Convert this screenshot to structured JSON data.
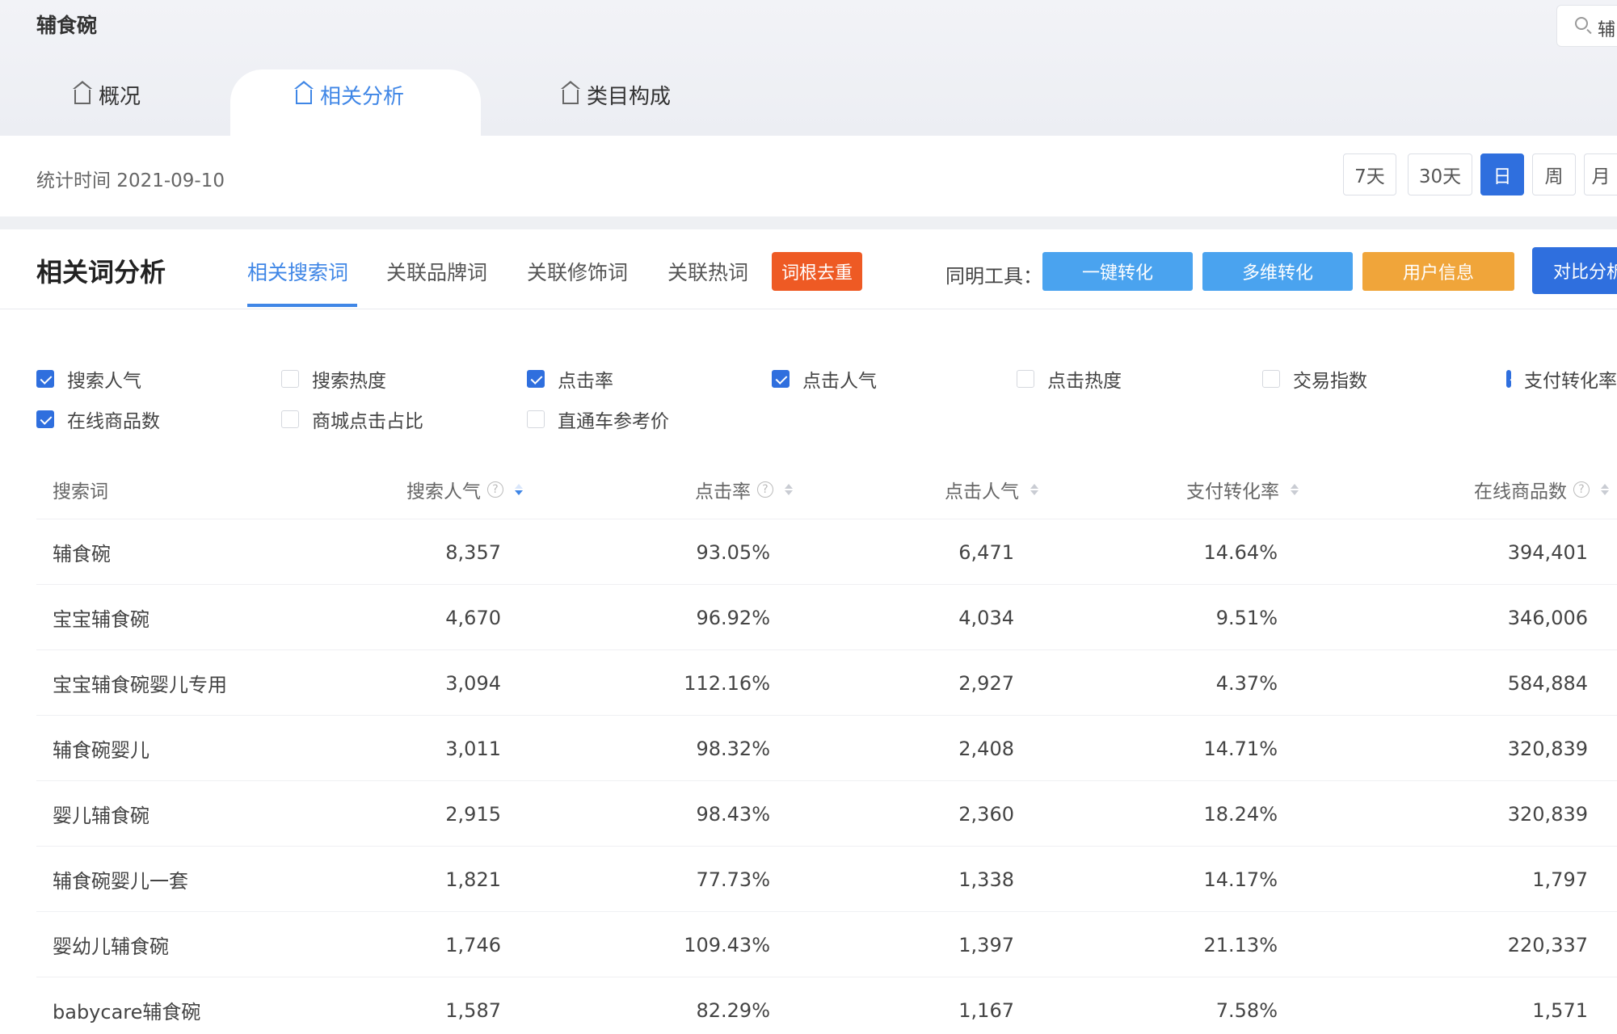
{
  "header": {
    "title": "辅食碗",
    "search_value": "辅",
    "tabs": [
      {
        "label": "概况",
        "active": false
      },
      {
        "label": "相关分析",
        "active": true
      },
      {
        "label": "类目构成",
        "active": false
      }
    ]
  },
  "stats": {
    "time_text": "统计时间 2021-09-10",
    "periods": [
      {
        "label": "7天",
        "active": false
      },
      {
        "label": "30天",
        "active": false
      },
      {
        "label": "日",
        "active": true
      },
      {
        "label": "周",
        "active": false
      },
      {
        "label": "月",
        "active": false
      }
    ]
  },
  "analysis": {
    "title": "相关词分析",
    "sub_tabs": [
      "相关搜索词",
      "关联品牌词",
      "关联修饰词",
      "关联热词"
    ],
    "dedup_label": "词根去重",
    "tools_label": "同明工具：",
    "tools": [
      {
        "label": "一键转化",
        "color": "#4aa3ef"
      },
      {
        "label": "多维转化",
        "color": "#4aa3ef"
      },
      {
        "label": "用户信息",
        "color": "#f0a53a"
      },
      {
        "label": "对比分析",
        "color": "#2f6fde"
      }
    ]
  },
  "metrics": [
    {
      "label": "搜索人气",
      "checked": true
    },
    {
      "label": "搜索热度",
      "checked": false
    },
    {
      "label": "点击率",
      "checked": true
    },
    {
      "label": "点击人气",
      "checked": true
    },
    {
      "label": "点击热度",
      "checked": false
    },
    {
      "label": "交易指数",
      "checked": false
    },
    {
      "label": "支付转化率",
      "checked": true
    },
    {
      "label": "在线商品数",
      "checked": true
    },
    {
      "label": "商城点击占比",
      "checked": false
    },
    {
      "label": "直通车参考价",
      "checked": false
    }
  ],
  "table": {
    "columns": [
      "搜索词",
      "搜索人气",
      "点击率",
      "点击人气",
      "支付转化率",
      "在线商品数"
    ],
    "rows": [
      [
        "辅食碗",
        "8,357",
        "93.05%",
        "6,471",
        "14.64%",
        "394,401"
      ],
      [
        "宝宝辅食碗",
        "4,670",
        "96.92%",
        "4,034",
        "9.51%",
        "346,006"
      ],
      [
        "宝宝辅食碗婴儿专用",
        "3,094",
        "112.16%",
        "2,927",
        "4.37%",
        "584,884"
      ],
      [
        "辅食碗婴儿",
        "3,011",
        "98.32%",
        "2,408",
        "14.71%",
        "320,839"
      ],
      [
        "婴儿辅食碗",
        "2,915",
        "98.43%",
        "2,360",
        "18.24%",
        "320,839"
      ],
      [
        "辅食碗婴儿一套",
        "1,821",
        "77.73%",
        "1,338",
        "14.17%",
        "1,797"
      ],
      [
        "婴幼儿辅食碗",
        "1,746",
        "109.43%",
        "1,397",
        "21.13%",
        "220,337"
      ],
      [
        "babycare辅食碗",
        "1,587",
        "82.29%",
        "1,167",
        "7.58%",
        "1,571"
      ]
    ]
  }
}
